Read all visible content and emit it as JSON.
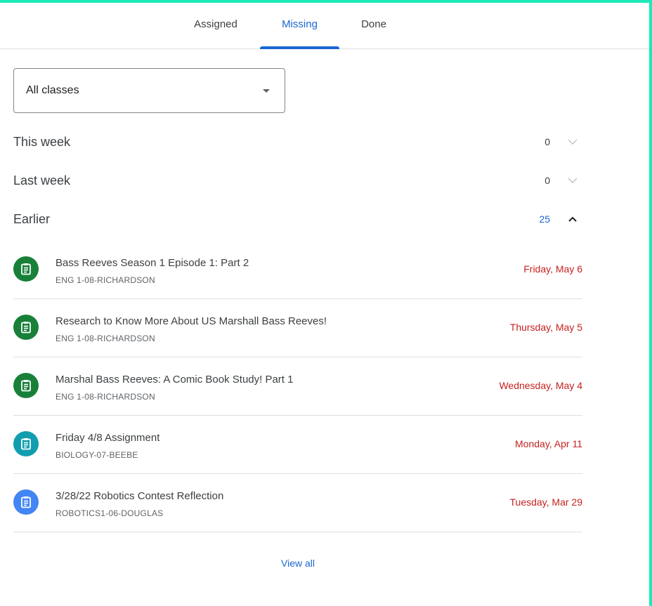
{
  "tabs": [
    {
      "label": "Assigned",
      "active": false
    },
    {
      "label": "Missing",
      "active": true
    },
    {
      "label": "Done",
      "active": false
    }
  ],
  "filter": {
    "selected": "All classes",
    "icon": "dropdown-caret-icon"
  },
  "sections": {
    "this_week": {
      "title": "This week",
      "count": "0",
      "expanded": false
    },
    "last_week": {
      "title": "Last week",
      "count": "0",
      "expanded": false
    },
    "earlier": {
      "title": "Earlier",
      "count": "25",
      "expanded": true
    }
  },
  "items": [
    {
      "title": "Bass Reeves Season 1 Episode 1: Part 2",
      "class": "ENG 1-08-RICHARDSON",
      "due": "Friday, May 6",
      "color": "#188038",
      "icon": "assignment-icon"
    },
    {
      "title": "Research to Know More About US Marshall Bass Reeves!",
      "class": "ENG 1-08-RICHARDSON",
      "due": "Thursday, May 5",
      "color": "#188038",
      "icon": "assignment-icon"
    },
    {
      "title": "Marshal Bass Reeves: A Comic Book Study! Part 1",
      "class": "ENG 1-08-RICHARDSON",
      "due": "Wednesday, May 4",
      "color": "#188038",
      "icon": "assignment-icon"
    },
    {
      "title": "Friday 4/8 Assignment",
      "class": "BIOLOGY-07-BEEBE",
      "due": "Monday, Apr 11",
      "color": "#129eaf",
      "icon": "assignment-icon"
    },
    {
      "title": "3/28/22 Robotics Contest Reflection",
      "class": "ROBOTICS1-06-DOUGLAS",
      "due": "Tuesday, Mar 29",
      "color": "#4285f4",
      "icon": "assignment-icon"
    }
  ],
  "view_all": "View all",
  "colors": {
    "accent": "#1967d2",
    "due": "#c5221f",
    "frame": "#1de9b6"
  }
}
